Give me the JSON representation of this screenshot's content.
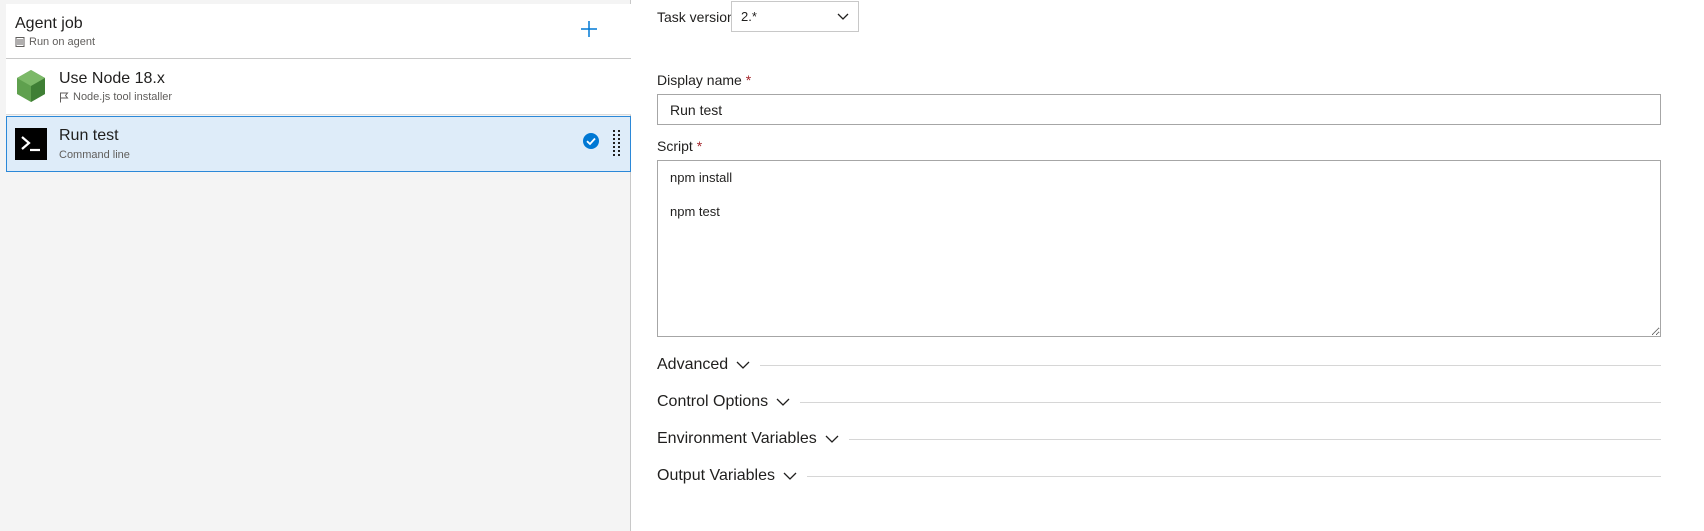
{
  "left_panel": {
    "job": {
      "title": "Agent job",
      "subtitle": "Run on agent",
      "subtitle_icon": "server-icon",
      "add_icon": "plus-icon"
    },
    "tasks": [
      {
        "title": "Use Node 18.x",
        "subtitle": "Node.js tool installer",
        "icon": "nodejs-icon",
        "subtitle_icon": "flag-icon",
        "selected": false
      },
      {
        "title": "Run test",
        "subtitle": "Command line",
        "icon": "terminal-icon",
        "selected": true,
        "status_icon": "check-circle-icon",
        "drag_icon": "drag-handle-icon"
      }
    ]
  },
  "form": {
    "task_version": {
      "label": "Task version",
      "value": "2.*"
    },
    "display_name": {
      "label": "Display name",
      "required_marker": "*",
      "value": "Run test"
    },
    "script": {
      "label": "Script",
      "required_marker": "*",
      "value": "npm install\n\nnpm test"
    },
    "sections": [
      {
        "label": "Advanced"
      },
      {
        "label": "Control Options"
      },
      {
        "label": "Environment Variables"
      },
      {
        "label": "Output Variables"
      }
    ]
  },
  "colors": {
    "accent": "#0078d4",
    "selected_bg": "#deecf9",
    "selected_border": "#2b88d8",
    "panel_bg": "#f4f4f4",
    "required": "#a4262c",
    "node_green": "#5fa04e"
  }
}
